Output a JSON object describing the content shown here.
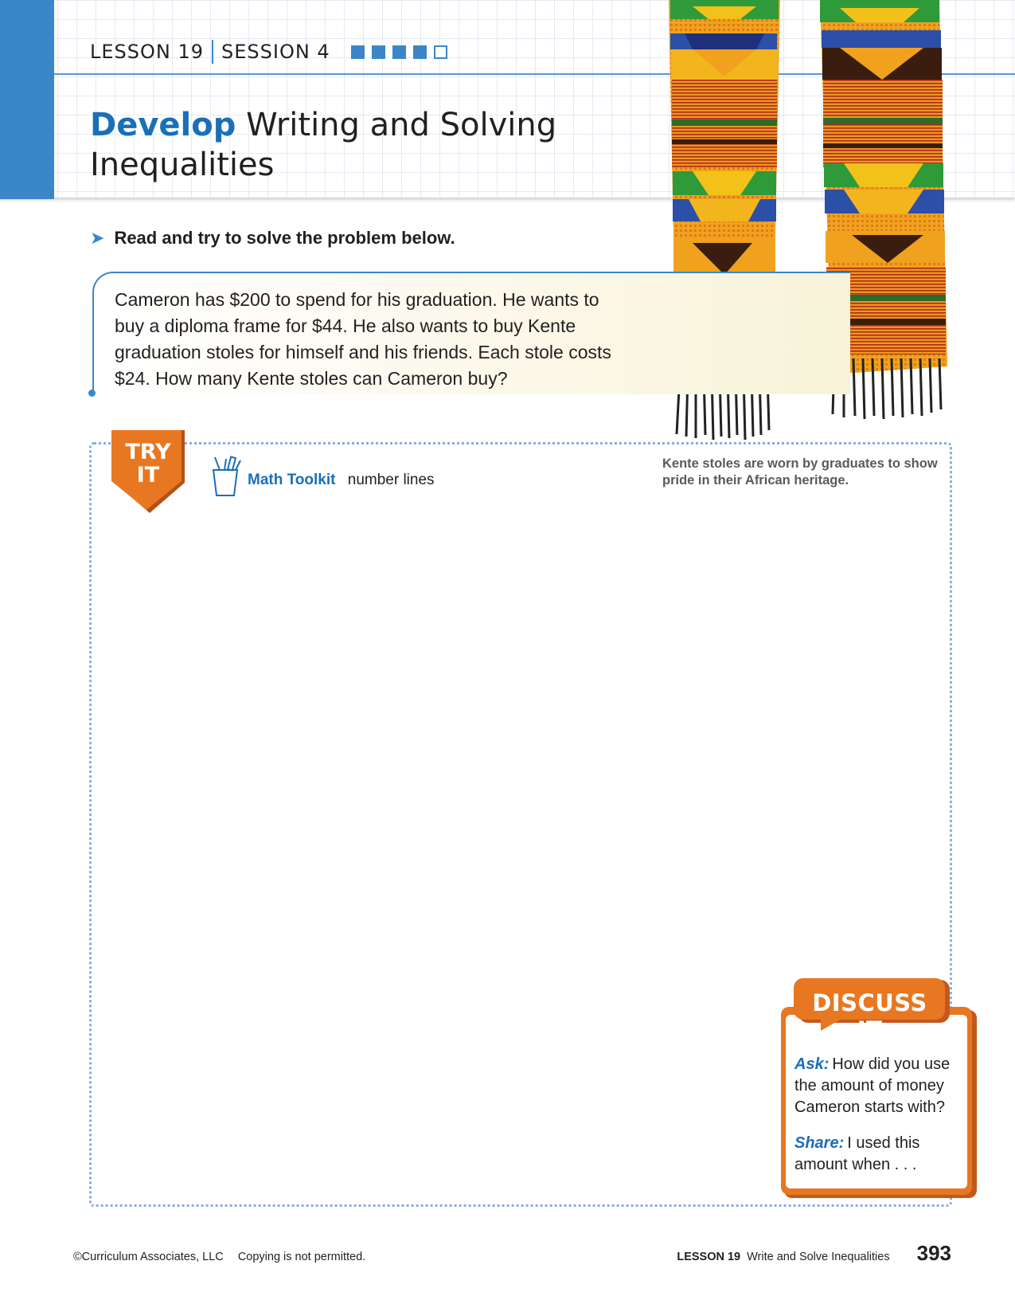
{
  "header": {
    "lesson": "LESSON 19",
    "session": "SESSION 4",
    "progress_filled": 4,
    "progress_total": 5,
    "title_strong": "Develop",
    "title_line1_rest": " Writing and Solving",
    "title_line2": "Inequalities"
  },
  "instruction": "Read and try to solve the problem below.",
  "problem": {
    "text": "Cameron has $200 to spend for his graduation. He wants to buy a diploma frame for $44. He also wants to buy Kente graduation stoles for himself and his friends. Each stole costs $24. How many Kente stoles can Cameron buy?"
  },
  "photo": {
    "caption": "Kente stoles are worn by graduates to show pride in their African heritage."
  },
  "try_it": {
    "badge_line1": "TRY",
    "badge_line2": "IT",
    "toolkit_label": "Math Toolkit",
    "toolkit_items": "number lines"
  },
  "discuss": {
    "title": "DISCUSS IT",
    "ask_label": "Ask:",
    "ask_text": "How did you use the amount of money Cameron starts with?",
    "share_label": "Share:",
    "share_text": "I used this amount when . . ."
  },
  "footer": {
    "copyright": "©Curriculum Associates, LLC",
    "notice": "Copying is not permitted.",
    "lesson": "LESSON 19",
    "lesson_title": "Write and Solve Inequalities",
    "page_number": "393"
  },
  "colors": {
    "accent_blue": "#3a86c8",
    "title_blue": "#1a6fb8",
    "orange": "#e87722"
  },
  "icons": [
    "chevron-arrow-icon",
    "pencil-cup-icon"
  ]
}
